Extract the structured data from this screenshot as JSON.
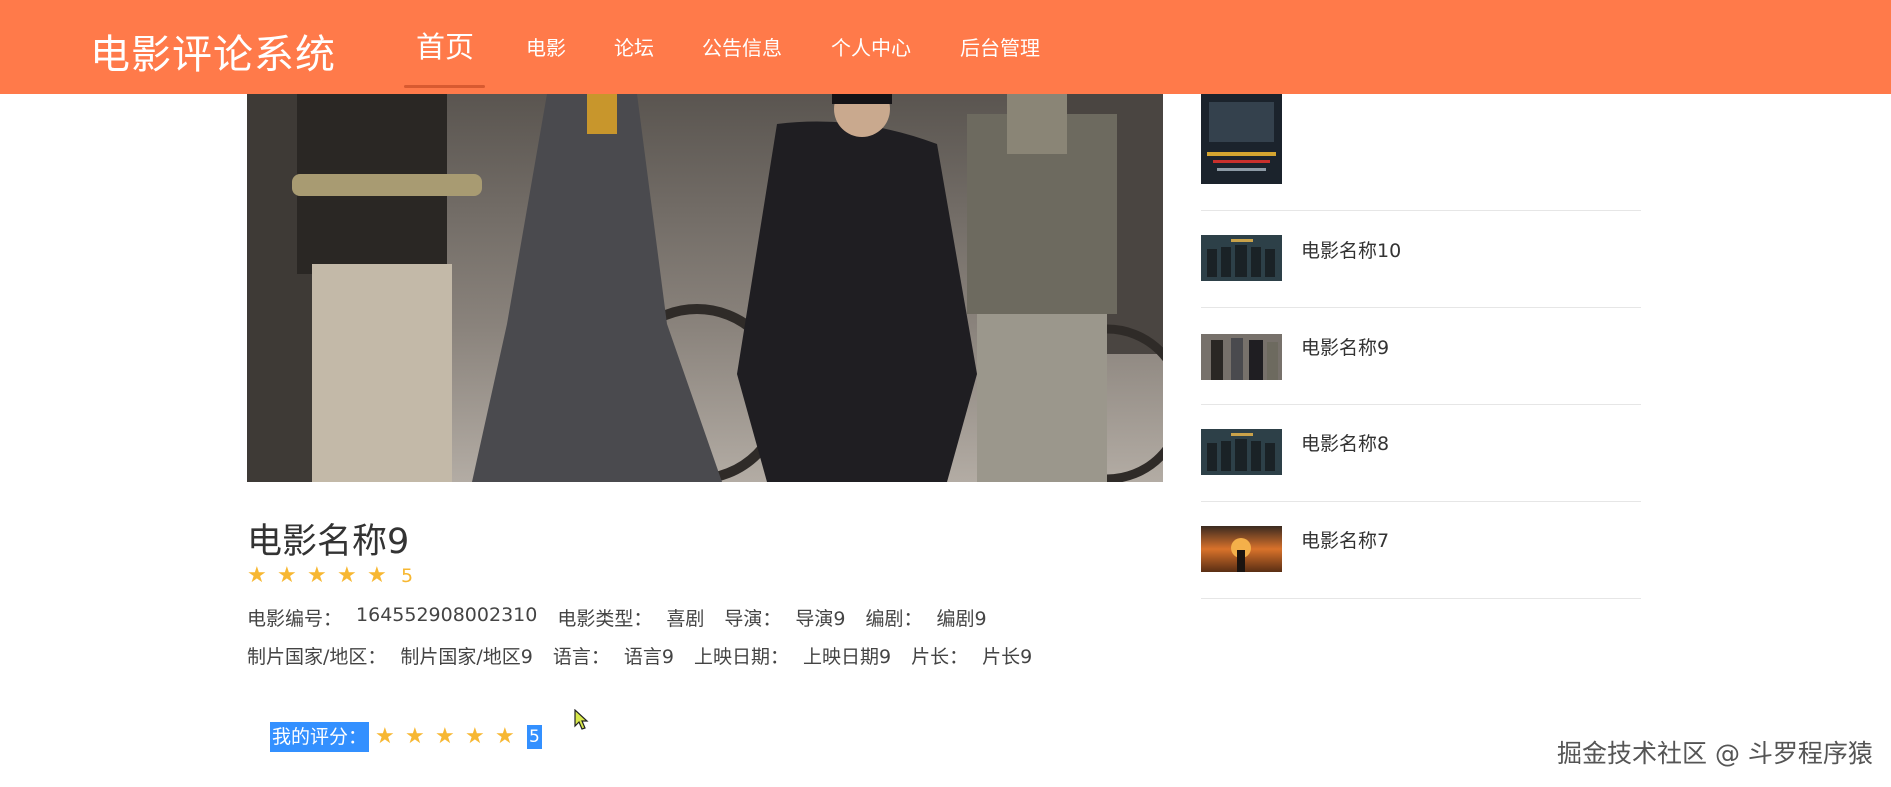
{
  "navbar": {
    "brand": "电影评论系统",
    "items": [
      {
        "label": "首页",
        "active": true
      },
      {
        "label": "电影",
        "active": false
      },
      {
        "label": "论坛",
        "active": false
      },
      {
        "label": "公告信息",
        "active": false
      },
      {
        "label": "个人中心",
        "active": false
      },
      {
        "label": "后台管理",
        "active": false
      }
    ],
    "background_color": "#ff7a4a"
  },
  "movie": {
    "title": "电影名称9",
    "rating_stars": 5,
    "rating_value": "5",
    "info_row1": [
      {
        "label": "电影编号：",
        "value": "164552908002310"
      },
      {
        "label": "电影类型：",
        "value": "喜剧"
      },
      {
        "label": "导演：",
        "value": "导演9"
      },
      {
        "label": "编剧：",
        "value": "编剧9"
      }
    ],
    "info_row2": [
      {
        "label": "制片国家/地区：",
        "value": "制片国家/地区9"
      },
      {
        "label": "语言：",
        "value": "语言9"
      },
      {
        "label": "上映日期：",
        "value": "上映日期9"
      },
      {
        "label": "片长：",
        "value": "片长9"
      }
    ]
  },
  "my_rating": {
    "label": "我的评分：",
    "stars": 5,
    "value": "5"
  },
  "sidebar": {
    "items": [
      {
        "name": "电影名称10"
      },
      {
        "name": "电影名称9"
      },
      {
        "name": "电影名称8"
      },
      {
        "name": "电影名称7"
      }
    ]
  },
  "watermark": "掘金技术社区 @ 斗罗程序猿",
  "colors": {
    "accent": "#ff7a4a",
    "star": "#f7b731",
    "selection": "#3390ff"
  },
  "icons": {
    "star": "star-icon",
    "cursor": "mouse-cursor-icon"
  }
}
